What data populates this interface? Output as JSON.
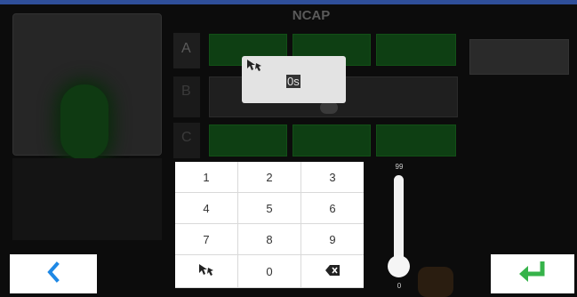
{
  "header": {
    "title": "NCAP"
  },
  "background": {
    "left_panel_label": "",
    "row_labels": [
      "A",
      "B",
      "C"
    ],
    "right_dash": "---"
  },
  "popup": {
    "icon": "hand-cursor-icon",
    "value": "0s"
  },
  "keypad": {
    "keys": [
      {
        "label": "1",
        "name": "key-1"
      },
      {
        "label": "2",
        "name": "key-2"
      },
      {
        "label": "3",
        "name": "key-3"
      },
      {
        "label": "4",
        "name": "key-4"
      },
      {
        "label": "5",
        "name": "key-5"
      },
      {
        "label": "6",
        "name": "key-6"
      },
      {
        "label": "7",
        "name": "key-7"
      },
      {
        "label": "8",
        "name": "key-8"
      },
      {
        "label": "9",
        "name": "key-9"
      },
      {
        "label": "",
        "name": "key-hand-cursor",
        "icon": "hand-cursor-icon"
      },
      {
        "label": "0",
        "name": "key-0"
      },
      {
        "label": "",
        "name": "key-backspace",
        "icon": "backspace-icon"
      }
    ]
  },
  "slider": {
    "max_label": "99",
    "min_label": "0",
    "value": 0
  },
  "nav": {
    "back_icon": "chevron-left-icon",
    "enter_icon": "enter-arrow-icon"
  },
  "colors": {
    "accent_blue": "#1e88e5",
    "enter_green": "#36b34a",
    "cell_green": "#0e3f13"
  }
}
